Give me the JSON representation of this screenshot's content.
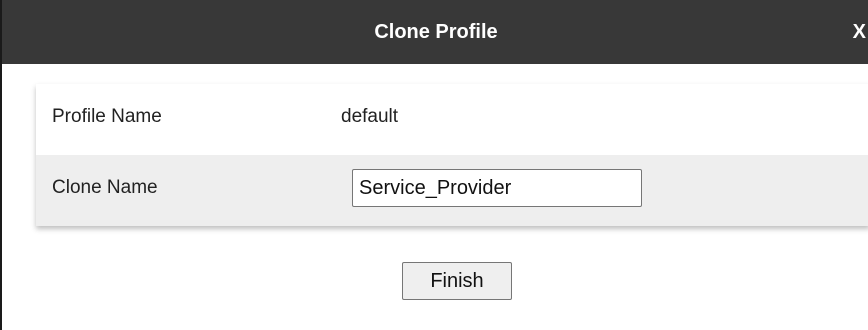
{
  "dialog": {
    "title": "Clone Profile",
    "close_label": "X"
  },
  "form": {
    "profile_name_label": "Profile Name",
    "profile_name_value": "default",
    "clone_name_label": "Clone Name",
    "clone_name_value": "Service_Provider"
  },
  "actions": {
    "finish_label": "Finish"
  },
  "colors": {
    "titlebar_bg": "#383838",
    "row_alt_bg": "#eeeeee"
  }
}
